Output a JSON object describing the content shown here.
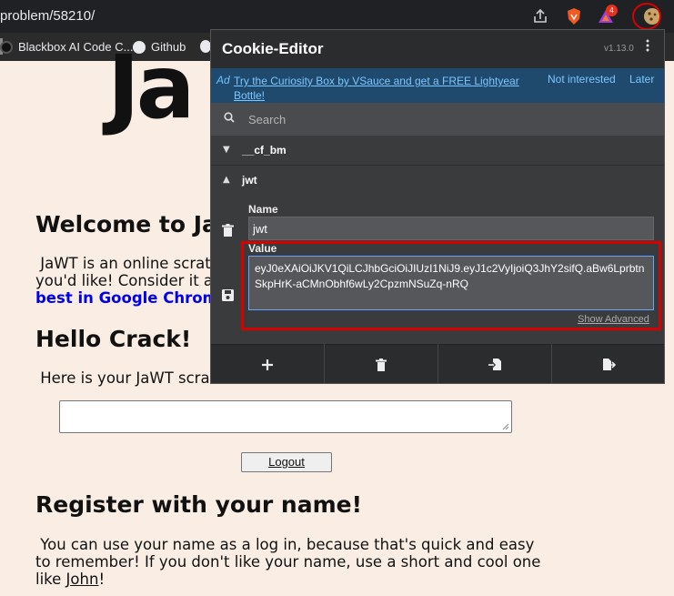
{
  "browser": {
    "url": "problem/58210/",
    "badge_count": "4",
    "bookmarks": [
      {
        "label": "Blackbox AI Code C...",
        "icon": "blackbox-icon"
      },
      {
        "label": "Github",
        "icon": "github-icon"
      }
    ]
  },
  "page": {
    "logo_partial": "Ja",
    "welcome_heading": "Welcome to Ja",
    "intro_line1": "JaWT is an online scrat",
    "intro_line2": "you'd like! Consider it a",
    "intro_link": "best in Google Chrom",
    "hello_heading": "Hello Crack!",
    "scratchpad_intro": "Here is your JaWT scrat",
    "logout_label": "Logout",
    "register_heading": "Register with your name!",
    "register_line1": "You can use your name as a log in, because that's quick and easy",
    "register_line2": "to remember! If you don't like your name, use a short and cool one",
    "register_line3_prefix": "like ",
    "register_name_example": "John",
    "register_line3_suffix": "!"
  },
  "popup": {
    "title": "Cookie-Editor",
    "version": "v1.13.0",
    "ad": {
      "tag": "Ad",
      "link": "Try the Curiosity Box by VSauce and get a FREE Lightyear Bottle!",
      "not_interested": "Not interested",
      "later": "Later"
    },
    "search_placeholder": "Search",
    "cookies": [
      {
        "name": "__cf_bm",
        "expanded": false
      },
      {
        "name": "jwt",
        "expanded": true
      }
    ],
    "editor": {
      "name_label": "Name",
      "name_value": "jwt",
      "value_label": "Value",
      "value_value": "eyJ0eXAiOiJKV1QiLCJhbGciOiJIUzI1NiJ9.eyJ1c2VyIjoiQ3JhY2sifQ.aBw6LprbtnSkpHrK-aCMnObhf6wLy2CpzmNSuZq-nRQ",
      "show_advanced": "Show Advanced"
    },
    "footer_icons": [
      "plus-icon",
      "trash-icon",
      "import-icon",
      "export-icon"
    ]
  },
  "colors": {
    "page_bg": "#faeee4",
    "highlight_red": "#d90000",
    "popup_bg": "#3a3b3d",
    "ad_bg": "#1f4a6e"
  }
}
